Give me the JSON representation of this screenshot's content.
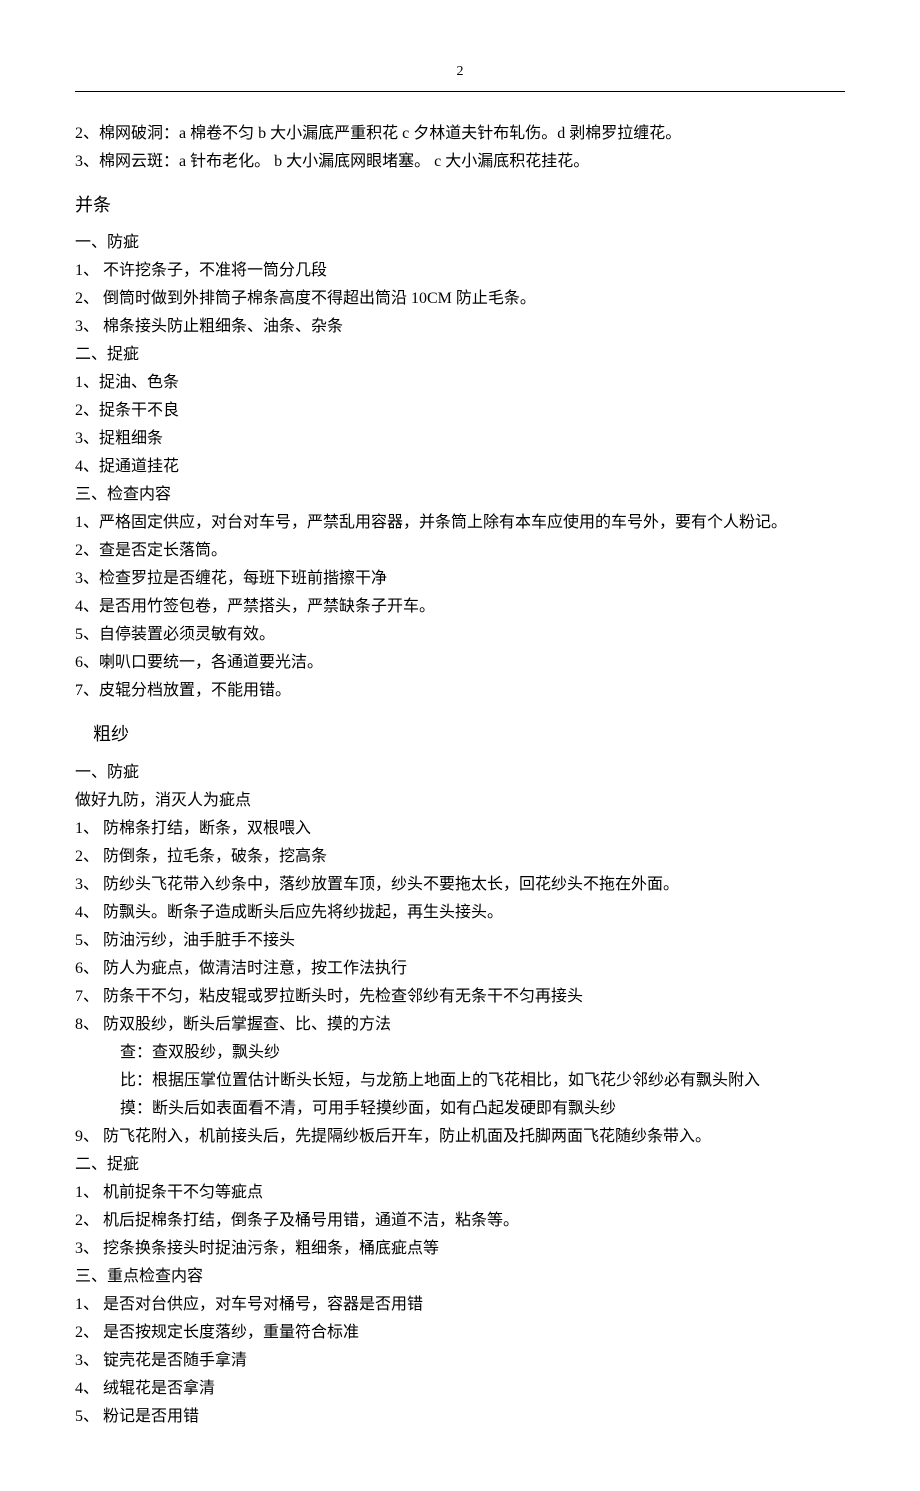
{
  "pageNumber": "2",
  "block1": {
    "lines": [
      "2、棉网破洞：a 棉卷不匀 b 大小漏底严重积花 c 夕林道夫针布轧伤。d 剥棉罗拉缠花。",
      "3、棉网云斑：a 针布老化。 b 大小漏底网眼堵塞。 c 大小漏底积花挂花。"
    ]
  },
  "section2": {
    "title": "并条",
    "sub1_title": "一、防疵",
    "sub1": [
      "1、 不许挖条子，不准将一筒分几段",
      "2、 倒筒时做到外排筒子棉条高度不得超出筒沿 10CM 防止毛条。",
      "3、 棉条接头防止粗细条、油条、杂条"
    ],
    "sub2_title": "二、捉疵",
    "sub2": [
      "1、捉油、色条",
      "2、捉条干不良",
      "3、捉粗细条",
      "4、捉通道挂花"
    ],
    "sub3_title": "三、检查内容",
    "sub3": [
      "1、严格固定供应，对台对车号，严禁乱用容器，并条筒上除有本车应使用的车号外，要有个人粉记。",
      "2、查是否定长落筒。",
      "3、检查罗拉是否缠花，每班下班前揩擦干净",
      "4、是否用竹签包卷，严禁搭头，严禁缺条子开车。",
      "5、自停装置必须灵敏有效。",
      "6、喇叭口要统一，各通道要光洁。",
      "7、皮辊分档放置，不能用错。"
    ]
  },
  "section3": {
    "title": "粗纱",
    "sub1_title": "一、防疵",
    "sub1_intro": "做好九防，消灭人为疵点",
    "sub1": [
      "1、 防棉条打结，断条，双根喂入",
      "2、 防倒条，拉毛条，破条，挖高条",
      "3、 防纱头飞花带入纱条中，落纱放置车顶，纱头不要拖太长，回花纱头不拖在外面。",
      "4、 防飘头。断条子造成断头后应先将纱拢起，再生头接头。",
      "5、 防油污纱，油手脏手不接头",
      "6、 防人为疵点，做清洁时注意，按工作法执行",
      "7、 防条干不匀，粘皮辊或罗拉断头时，先检查邻纱有无条干不匀再接头",
      "8、 防双股纱，断头后掌握查、比、摸的方法"
    ],
    "sub1_detail": [
      "查：查双股纱，飘头纱",
      "比：根据压掌位置估计断头长短，与龙筋上地面上的飞花相比，如飞花少邻纱必有飘头附入",
      "摸：断头后如表面看不清，可用手轻摸纱面，如有凸起发硬即有飘头纱"
    ],
    "sub1_last": "9、 防飞花附入，机前接头后，先提隔纱板后开车，防止机面及托脚两面飞花随纱条带入。",
    "sub2_title": "二、捉疵",
    "sub2": [
      "1、 机前捉条干不匀等疵点",
      "2、 机后捉棉条打结，倒条子及桶号用错，通道不洁，粘条等。",
      "3、 挖条换条接头时捉油污条，粗细条，桶底疵点等"
    ],
    "sub3_title": "三、重点检查内容",
    "sub3": [
      "1、 是否对台供应，对车号对桶号，容器是否用错",
      "2、 是否按规定长度落纱，重量符合标准",
      "3、 锭壳花是否随手拿清",
      "4、 绒辊花是否拿清",
      "5、 粉记是否用错"
    ]
  }
}
